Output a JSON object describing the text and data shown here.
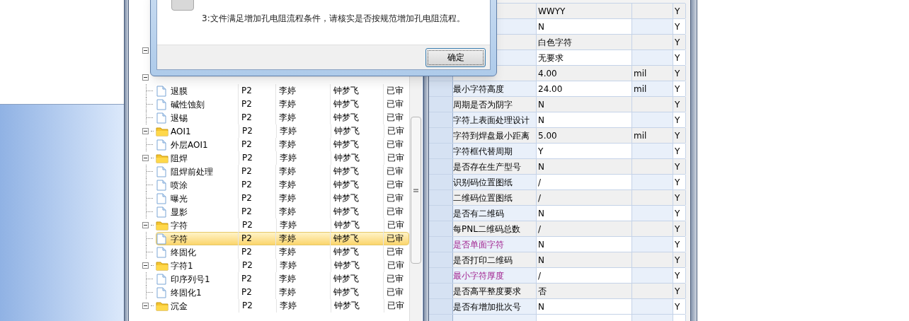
{
  "dialog": {
    "message": "3:文件满足增加孔电阻流程条件，请核实是否按规范增加孔电阻流程。",
    "ok_button": "确定"
  },
  "tree": {
    "nodes": [
      {
        "expanded": true,
        "children": [
          {
            "name": "退膜",
            "cells": [
              "P2",
              "李婷",
              "钟梦飞",
              "已审"
            ],
            "selected": false
          },
          {
            "name": "碱性蚀刻",
            "cells": [
              "P2",
              "李婷",
              "钟梦飞",
              "已审"
            ],
            "selected": false
          },
          {
            "name": "退锡",
            "cells": [
              "P2",
              "李婷",
              "钟梦飞",
              "已审"
            ],
            "selected": false
          }
        ]
      },
      {
        "name": "AOI1",
        "cells": [
          "P2",
          "李婷",
          "钟梦飞",
          "已审"
        ],
        "expanded": true,
        "children": [
          {
            "name": "外层AOI1",
            "cells": [
              "P2",
              "李婷",
              "钟梦飞",
              "已审"
            ],
            "selected": false
          }
        ]
      },
      {
        "name": "阻焊",
        "cells": [
          "P2",
          "李婷",
          "钟梦飞",
          "已审"
        ],
        "expanded": true,
        "children": [
          {
            "name": "阻焊前处理",
            "cells": [
              "P2",
              "李婷",
              "钟梦飞",
              "已审"
            ],
            "selected": false
          },
          {
            "name": "喷涂",
            "cells": [
              "P2",
              "李婷",
              "钟梦飞",
              "已审"
            ],
            "selected": false
          },
          {
            "name": "曝光",
            "cells": [
              "P2",
              "李婷",
              "钟梦飞",
              "已审"
            ],
            "selected": false
          },
          {
            "name": "显影",
            "cells": [
              "P2",
              "李婷",
              "钟梦飞",
              "已审"
            ],
            "selected": false
          }
        ]
      },
      {
        "name": "字符",
        "cells": [
          "P2",
          "李婷",
          "钟梦飞",
          "已审"
        ],
        "expanded": true,
        "children": [
          {
            "name": "字符",
            "cells": [
              "P2",
              "李婷",
              "钟梦飞",
              "已审"
            ],
            "selected": true
          },
          {
            "name": "终固化",
            "cells": [
              "P2",
              "李婷",
              "钟梦飞",
              "已审"
            ],
            "selected": false
          }
        ]
      },
      {
        "name": "字符1",
        "cells": [
          "P2",
          "李婷",
          "钟梦飞",
          "已审"
        ],
        "expanded": true,
        "children": [
          {
            "name": "印序列号1",
            "cells": [
              "P2",
              "李婷",
              "钟梦飞",
              "已审"
            ],
            "selected": false
          },
          {
            "name": "终固化1",
            "cells": [
              "P2",
              "李婷",
              "钟梦飞",
              "已审"
            ],
            "selected": false
          }
        ]
      },
      {
        "name": "沉金",
        "cells": [
          "P2",
          "李婷",
          "钟梦飞",
          "已审"
        ],
        "expanded": true
      }
    ]
  },
  "properties": {
    "rows": [
      {
        "value": "WWYY",
        "flag": "Y"
      },
      {
        "value": "N",
        "flag": "Y"
      },
      {
        "value": "白色字符",
        "flag": "Y"
      },
      {
        "value": "无要求",
        "flag": "Y"
      },
      {
        "value": "4.00",
        "unit": "mil",
        "flag": "Y"
      },
      {
        "name": "最小字符高度",
        "value": "24.00",
        "unit": "mil",
        "flag": "Y",
        "highlighted": false
      },
      {
        "name": "周期是否为阴字",
        "value": "N",
        "flag": "Y",
        "highlighted": false
      },
      {
        "name": "字符上表面处理设计",
        "value": "N",
        "flag": "Y",
        "highlighted": false
      },
      {
        "name": "字符到焊盘最小距离",
        "value": "5.00",
        "unit": "mil",
        "flag": "Y",
        "highlighted": false
      },
      {
        "name": "字符框代替周期",
        "value": "Y",
        "flag": "Y",
        "highlighted": false
      },
      {
        "name": "是否存在生产型号",
        "value": "N",
        "flag": "Y",
        "highlighted": false
      },
      {
        "name": "识别码位置图纸",
        "value": "/",
        "flag": "Y",
        "highlighted": false
      },
      {
        "name": "二维码位置图纸",
        "value": "/",
        "flag": "Y",
        "highlighted": false
      },
      {
        "name": "是否有二维码",
        "value": "N",
        "flag": "Y",
        "highlighted": false
      },
      {
        "name": "每PNL二维码总数",
        "value": "/",
        "flag": "Y",
        "highlighted": false
      },
      {
        "name": "是否单面字符",
        "value": "N",
        "flag": "Y",
        "highlighted": true
      },
      {
        "name": "是否打印二维码",
        "value": "N",
        "flag": "Y",
        "highlighted": false
      },
      {
        "name": "最小字符厚度",
        "value": "/",
        "flag": "Y",
        "highlighted": true
      },
      {
        "name": "是否高平整度要求",
        "value": "否",
        "flag": "Y",
        "highlighted": false
      },
      {
        "name": "是否有增加批次号",
        "value": "N",
        "flag": "Y",
        "highlighted": false
      }
    ]
  }
}
